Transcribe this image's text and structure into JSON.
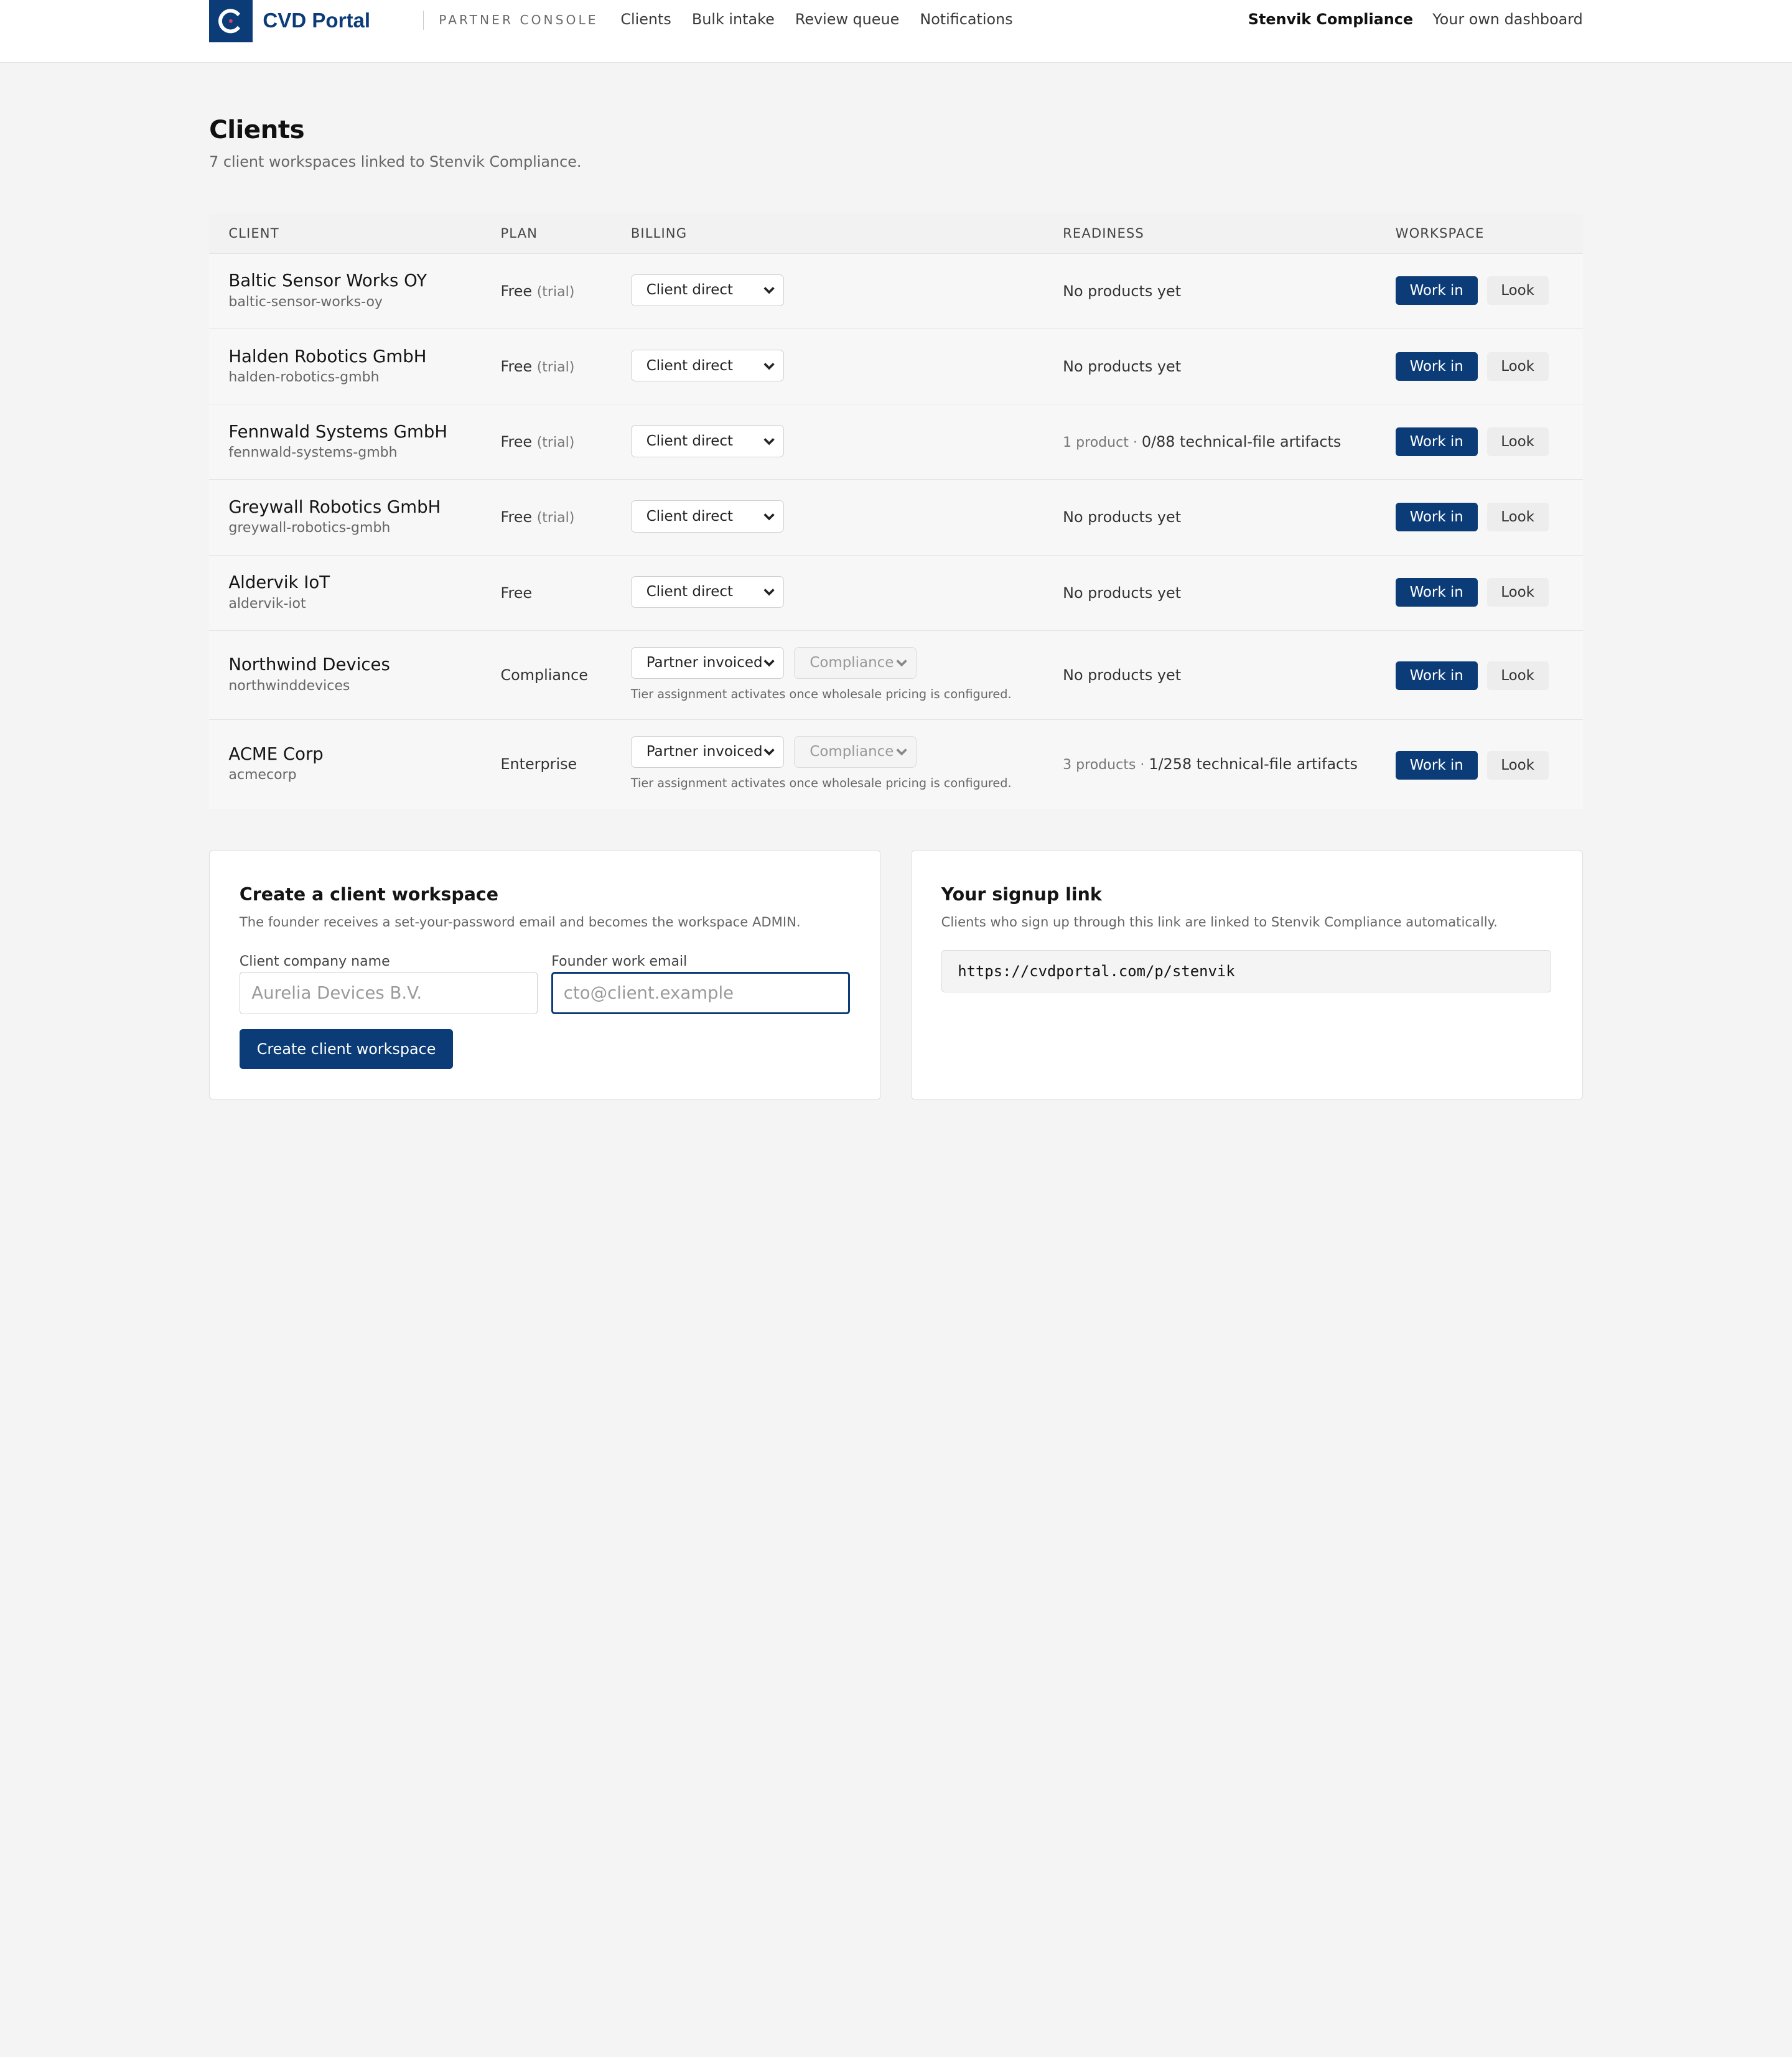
{
  "header": {
    "brand": "CVD Portal",
    "console_label": "PARTNER CONSOLE",
    "nav": [
      "Clients",
      "Bulk intake",
      "Review queue",
      "Notifications"
    ],
    "org_name": "Stenvik Compliance",
    "dashboard_link": "Your own dashboard"
  },
  "page": {
    "title": "Clients",
    "subtitle": "7 client workspaces linked to Stenvik Compliance."
  },
  "table": {
    "columns": [
      "CLIENT",
      "PLAN",
      "BILLING",
      "READINESS",
      "WORKSPACE"
    ],
    "rows": [
      {
        "name": "Baltic Sensor Works OY",
        "slug": "baltic-sensor-works-oy",
        "plan": "Free",
        "plan_note": "(trial)",
        "billing": "Client direct",
        "readiness_muted": "",
        "readiness": "No products yet",
        "work_label": "Work in",
        "look_label": "Look"
      },
      {
        "name": "Halden Robotics GmbH",
        "slug": "halden-robotics-gmbh",
        "plan": "Free",
        "plan_note": "(trial)",
        "billing": "Client direct",
        "readiness_muted": "",
        "readiness": "No products yet",
        "work_label": "Work in",
        "look_label": "Look"
      },
      {
        "name": "Fennwald Systems GmbH",
        "slug": "fennwald-systems-gmbh",
        "plan": "Free",
        "plan_note": "(trial)",
        "billing": "Client direct",
        "readiness_muted": "1 product · ",
        "readiness": "0/88 technical-file artifacts",
        "work_label": "Work in",
        "look_label": "Look"
      },
      {
        "name": "Greywall Robotics GmbH",
        "slug": "greywall-robotics-gmbh",
        "plan": "Free",
        "plan_note": "(trial)",
        "billing": "Client direct",
        "readiness_muted": "",
        "readiness": "No products yet",
        "work_label": "Work in",
        "look_label": "Look"
      },
      {
        "name": "Aldervik IoT",
        "slug": "aldervik-iot",
        "plan": "Free",
        "plan_note": "",
        "billing": "Client direct",
        "readiness_muted": "",
        "readiness": "No products yet",
        "work_label": "Work in",
        "look_label": "Look"
      },
      {
        "name": "Northwind Devices",
        "slug": "northwinddevices",
        "plan": "Compliance",
        "plan_note": "",
        "billing": "Partner invoiced",
        "tier": "Compliance",
        "tier_note": "Tier assignment activates once wholesale pricing is configured.",
        "readiness_muted": "",
        "readiness": "No products yet",
        "work_label": "Work in",
        "look_label": "Look"
      },
      {
        "name": "ACME Corp",
        "slug": "acmecorp",
        "plan": "Enterprise",
        "plan_note": "",
        "billing": "Partner invoiced",
        "tier": "Compliance",
        "tier_note": "Tier assignment activates once wholesale pricing is configured.",
        "readiness_muted": "3 products · ",
        "readiness": "1/258 technical-file artifacts",
        "work_label": "Work in",
        "look_label": "Look"
      }
    ]
  },
  "create_card": {
    "title": "Create a client workspace",
    "description": "The founder receives a set-your-password email and becomes the workspace ADMIN.",
    "company_label": "Client company name",
    "company_placeholder": "Aurelia Devices B.V.",
    "email_label": "Founder work email",
    "email_placeholder": "cto@client.example",
    "submit_label": "Create client workspace"
  },
  "signup_card": {
    "title": "Your signup link",
    "description": "Clients who sign up through this link are linked to Stenvik Compliance automatically.",
    "link": "https://cvdportal.com/p/stenvik"
  },
  "colors": {
    "primary": "#0b3c78",
    "background": "#f4f4f4"
  },
  "icons": {
    "logo": "cvd-logo-icon",
    "select_arrow": "chevron-down-icon"
  }
}
